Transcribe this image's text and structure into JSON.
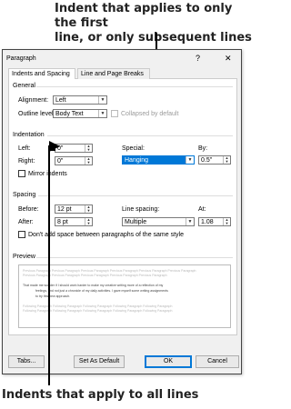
{
  "callouts": {
    "top_line1": "Indent that applies to only the first",
    "top_line2": "line, or only subsequent lines",
    "bottom": "Indents that apply to all lines"
  },
  "dialog": {
    "title": "Paragraph",
    "help": "?",
    "close": "✕",
    "tabs": [
      "Indents and Spacing",
      "Line and Page Breaks"
    ],
    "general": {
      "heading": "General",
      "alignment_label": "Alignment:",
      "alignment_value": "Left",
      "outline_label": "Outline level:",
      "outline_value": "Body Text",
      "collapsed_label": "Collapsed by default"
    },
    "indentation": {
      "heading": "Indentation",
      "left_label": "Left:",
      "left_value": "0\"",
      "right_label": "Right:",
      "right_value": "0\"",
      "special_label": "Special:",
      "special_value": "Hanging",
      "by_label": "By:",
      "by_value": "0.5\"",
      "mirror_label": "Mirror indents"
    },
    "spacing": {
      "heading": "Spacing",
      "before_label": "Before:",
      "before_value": "12 pt",
      "after_label": "After:",
      "after_value": "8 pt",
      "line_spacing_label": "Line spacing:",
      "line_spacing_value": "Multiple",
      "at_label": "At:",
      "at_value": "1.08",
      "dont_add_label": "Don't add space between paragraphs of the same style"
    },
    "preview": {
      "heading": "Preview",
      "prev_para_1": "Previous Paragraph Previous Paragraph Previous Paragraph Previous Paragraph Previous Paragraph Previous Paragraph",
      "prev_para_2": "Previous Paragraph Previous Paragraph Previous Paragraph Previous Paragraph Previous Paragraph",
      "sample_1": "That made me wonder if I should work harder to make my creative writing more of a reflection of my",
      "sample_2": "feelings, and not just a chronicle of my daily activities. I gave myself some writing assignments",
      "sample_3": "to try this new approach.",
      "next_para_1": "Following Paragraph Following Paragraph Following Paragraph Following Paragraph Following Paragraph",
      "next_para_2": "Following Paragraph Following Paragraph Following Paragraph Following Paragraph Following Paragraph"
    },
    "buttons": {
      "tabs": "Tabs...",
      "set_default": "Set As Default",
      "ok": "OK",
      "cancel": "Cancel"
    }
  }
}
